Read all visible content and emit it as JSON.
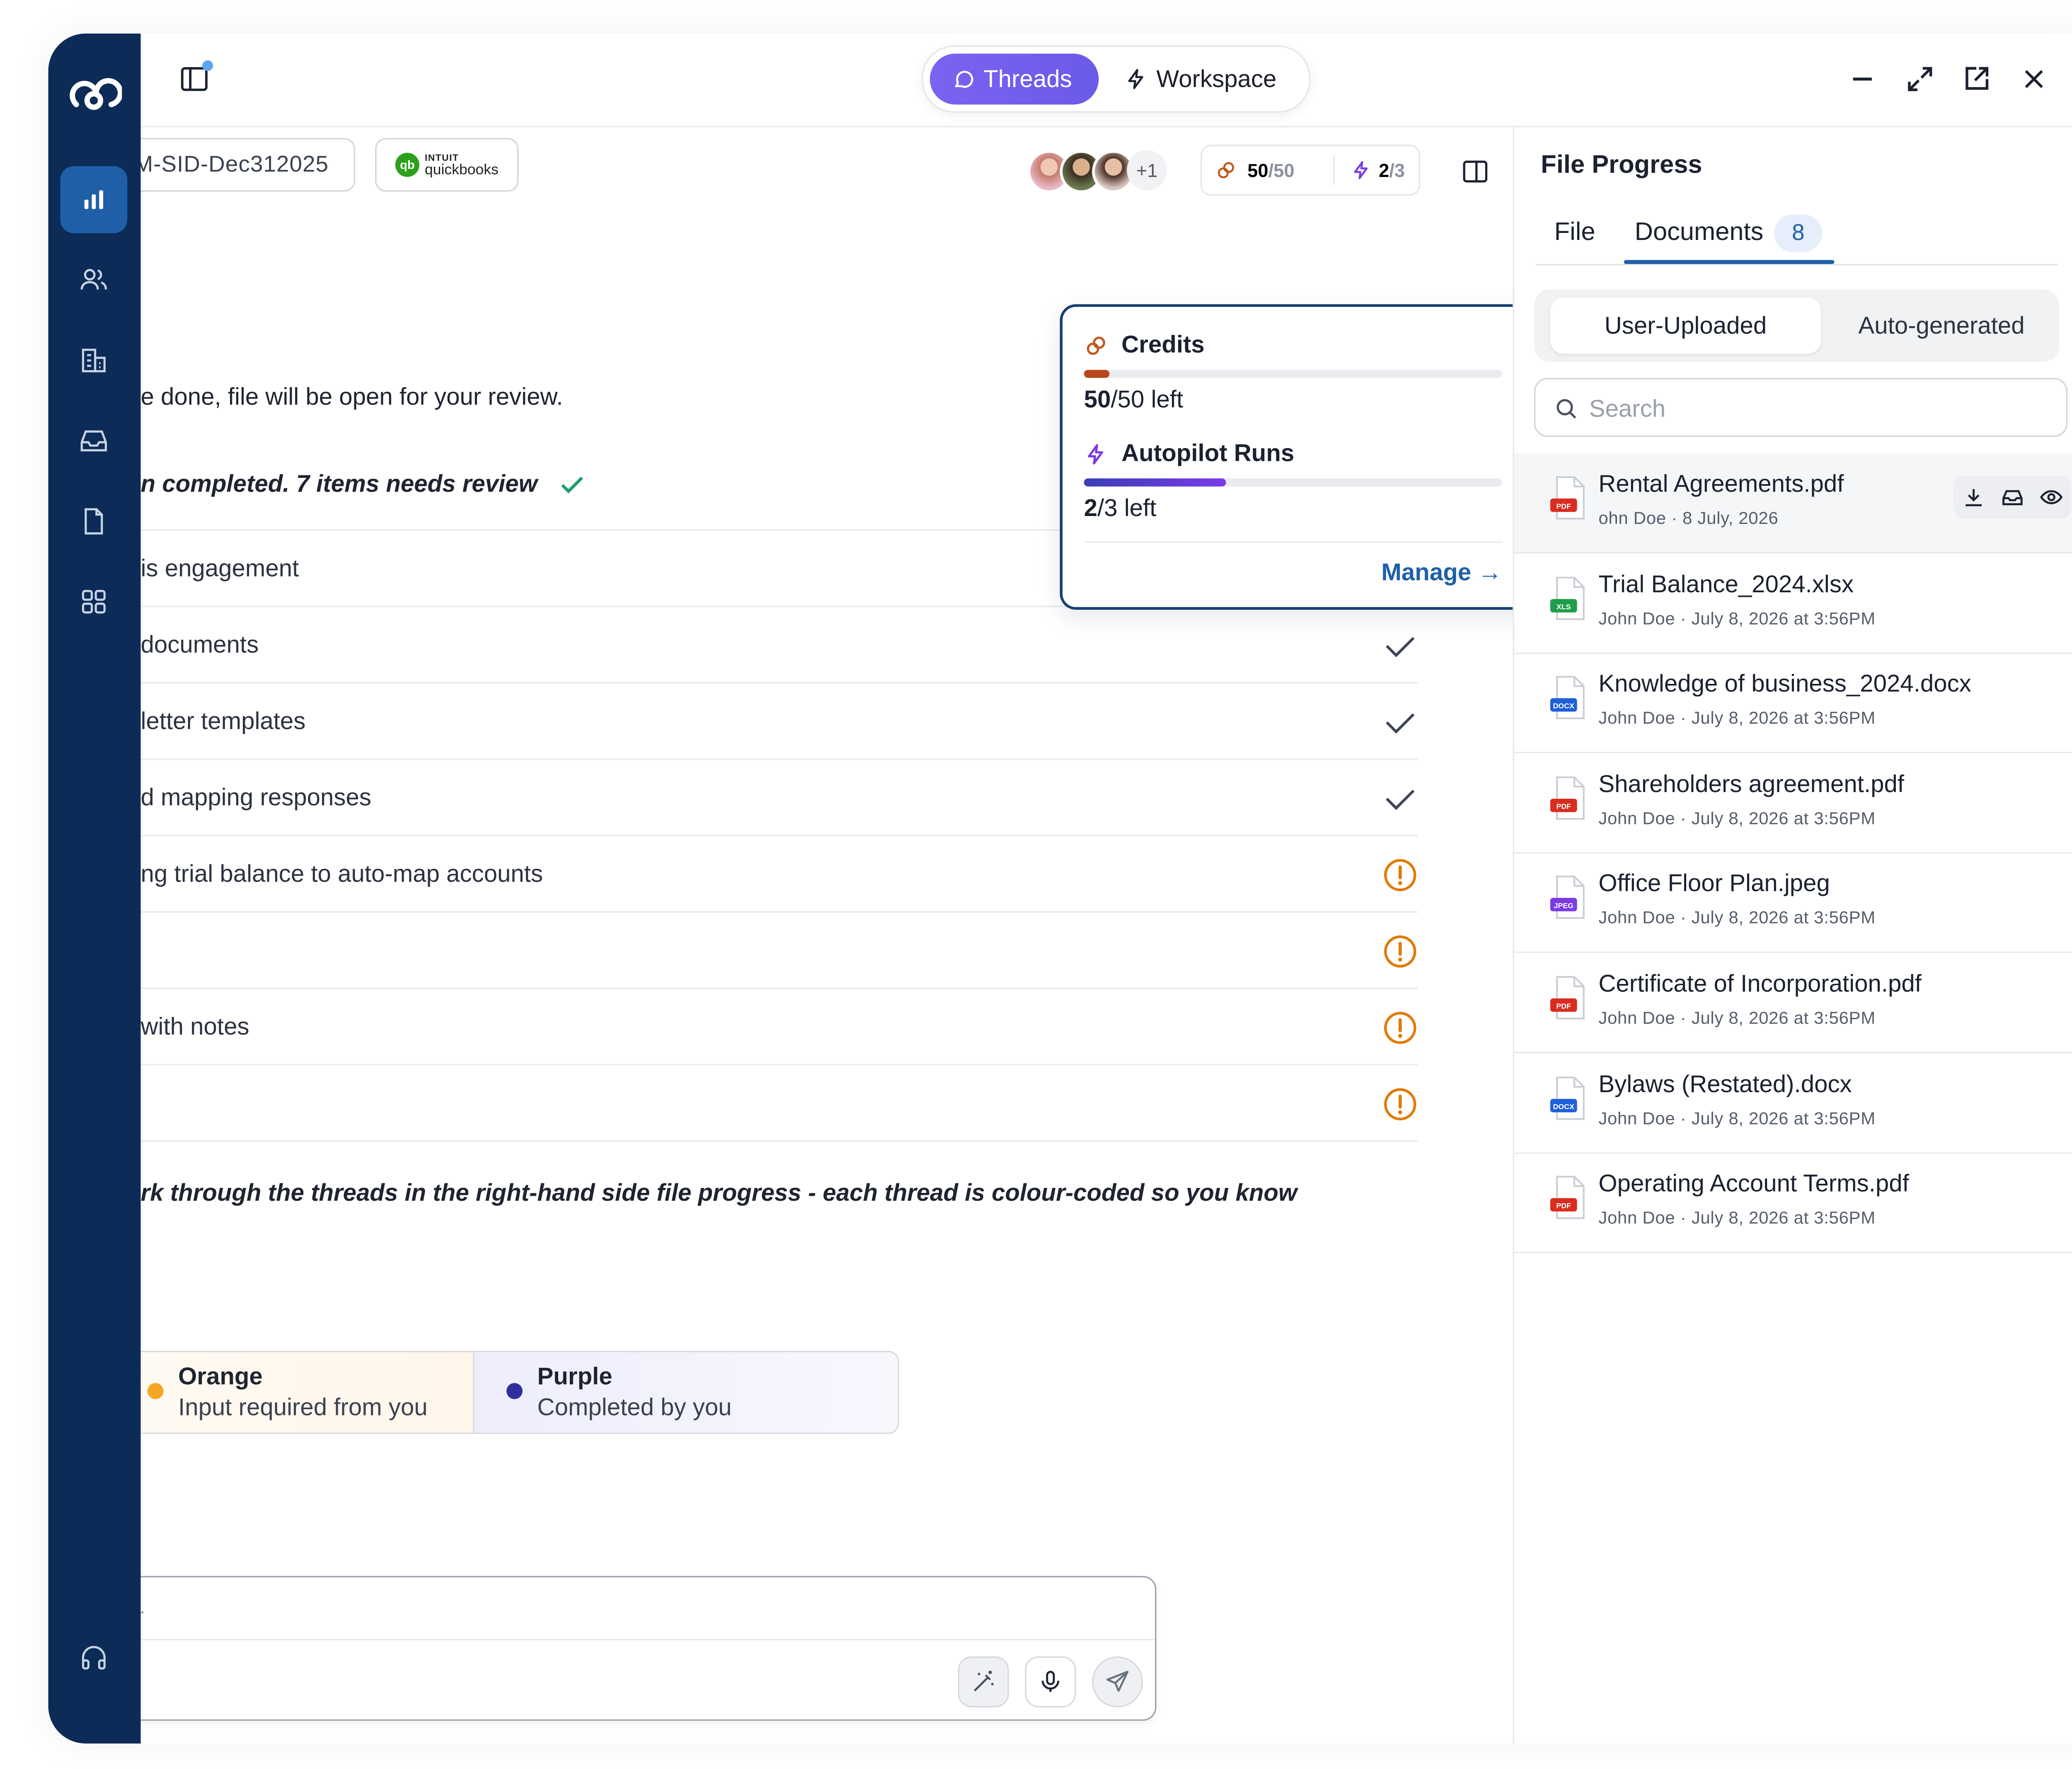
{
  "app": {
    "mode_tabs": [
      {
        "label": "Threads",
        "active": true,
        "icon": "chat-bubble-icon"
      },
      {
        "label": "Workspace",
        "active": false,
        "icon": "lightning-icon"
      }
    ],
    "accent_color": "#6a5be8",
    "sidebar_color": "#0c2b57"
  },
  "sidebar": {
    "items": [
      {
        "name": "analytics",
        "icon": "bar-chart-icon",
        "active": true
      },
      {
        "name": "people",
        "icon": "users-icon",
        "active": false
      },
      {
        "name": "organizations",
        "icon": "building-icon",
        "active": false
      },
      {
        "name": "inbox",
        "icon": "inbox-icon",
        "active": false
      },
      {
        "name": "documents",
        "icon": "document-icon",
        "active": false
      },
      {
        "name": "apps",
        "icon": "grid-icon",
        "active": false
      }
    ],
    "support_icon": "headset-icon"
  },
  "header": {
    "file_chip": "M-SID-Dec312025",
    "integration": {
      "brand_top": "INTUIT",
      "brand_bottom": "quickbooks",
      "logo_text": "qb"
    },
    "avatars_more": "+1",
    "credits": {
      "used": "50",
      "total": "/50"
    },
    "runs": {
      "used": "2",
      "total": "/3"
    }
  },
  "popover": {
    "credits_title": "Credits",
    "credits_progress": 0.06,
    "credits_value": "50",
    "credits_suffix": "/50 left",
    "runs_title": "Autopilot Runs",
    "runs_progress": 0.34,
    "runs_value": "2",
    "runs_suffix": "/3 left",
    "manage_label": "Manage →"
  },
  "chat": {
    "line1": "e done, file will be open for your review.",
    "line2": "n completed. 7 items needs review",
    "checklist": [
      {
        "label": "is engagement",
        "status": "done"
      },
      {
        "label": "documents",
        "status": "done"
      },
      {
        "label": "letter templates",
        "status": "done"
      },
      {
        "label": "d mapping responses",
        "status": "done"
      },
      {
        "label": "ng trial balance to auto-map accounts",
        "status": "attention"
      },
      {
        "label": "",
        "status": "attention"
      },
      {
        "label": " with notes",
        "status": "attention"
      },
      {
        "label": "",
        "status": "attention"
      }
    ],
    "line3": "rk through the threads in the right-hand side file progress - each thread is colour-coded so you know",
    "legend": [
      {
        "title": "Orange",
        "desc": "Input required from you",
        "color": "#f5a623"
      },
      {
        "title": "Purple",
        "desc": "Completed by you",
        "color": "#2f2f9e"
      }
    ],
    "composer_placeholder": "."
  },
  "file_progress": {
    "title": "File Progress",
    "tabs": [
      {
        "label": "File",
        "active": false
      },
      {
        "label": "Documents",
        "active": true,
        "count": "8"
      }
    ],
    "subtabs": [
      {
        "label": "User-Uploaded",
        "active": true
      },
      {
        "label": "Auto-generated",
        "active": false
      }
    ],
    "search_placeholder": "Search",
    "files": [
      {
        "name": "Rental Agreements.pdf",
        "meta": "ohn Doe · 8 July, 2026",
        "type": "PDF",
        "type_color": "#d92d20",
        "hover": true
      },
      {
        "name": "Trial Balance_2024.xlsx",
        "meta": "John Doe · July 8, 2026 at 3:56PM",
        "type": "XLS",
        "type_color": "#1e9e4a"
      },
      {
        "name": "Knowledge of business_2024.docx",
        "meta": "John Doe · July 8, 2026 at 3:56PM",
        "type": "DOCX",
        "type_color": "#1f5fd8"
      },
      {
        "name": "Shareholders agreement.pdf",
        "meta": "John Doe · July 8, 2026 at 3:56PM",
        "type": "PDF",
        "type_color": "#d92d20"
      },
      {
        "name": "Office Floor Plan.jpeg",
        "meta": "John Doe · July 8, 2026 at 3:56PM",
        "type": "JPEG",
        "type_color": "#7a3be6"
      },
      {
        "name": "Certificate of Incorporation.pdf",
        "meta": "John Doe · July 8, 2026 at 3:56PM",
        "type": "PDF",
        "type_color": "#d92d20"
      },
      {
        "name": "Bylaws (Restated).docx",
        "meta": "John Doe · July 8, 2026 at 3:56PM",
        "type": "DOCX",
        "type_color": "#1f5fd8"
      },
      {
        "name": "Operating Account Terms.pdf",
        "meta": "John Doe · July 8, 2026 at 3:56PM",
        "type": "PDF",
        "type_color": "#d92d20"
      }
    ]
  }
}
